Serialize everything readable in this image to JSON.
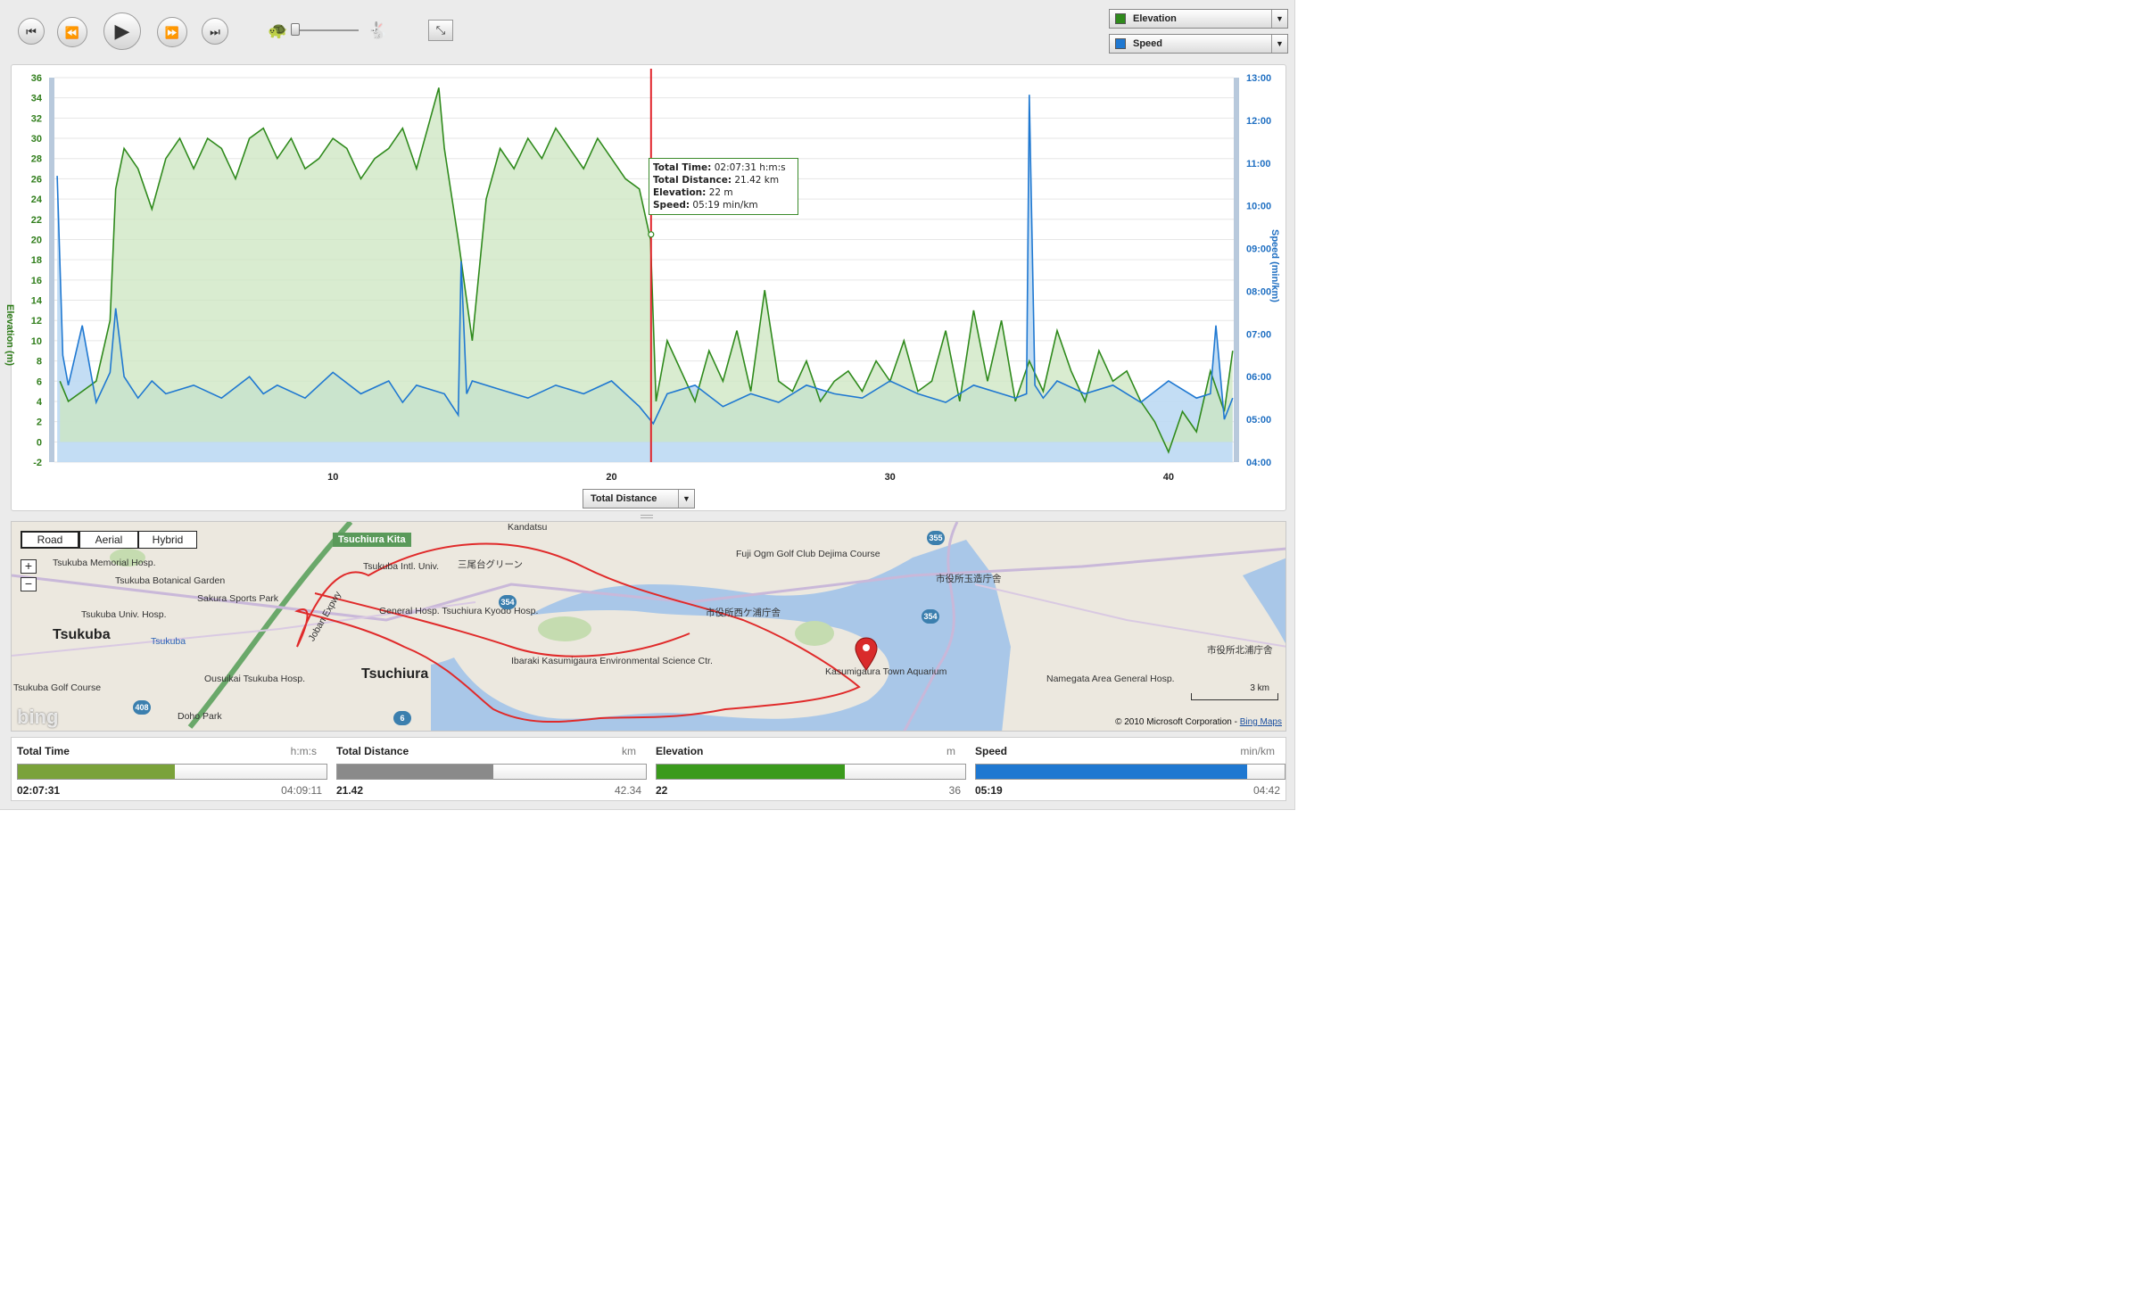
{
  "toolbar": {
    "buttons": [
      {
        "name": "skip-to-start-button",
        "glyph": "⏮"
      },
      {
        "name": "step-back-button",
        "glyph": "⏪"
      },
      {
        "name": "play-button",
        "glyph": "▶"
      },
      {
        "name": "step-forward-button",
        "glyph": "⏩"
      },
      {
        "name": "skip-to-end-button",
        "glyph": "⏭"
      }
    ],
    "slow_icon": "tortoise-icon",
    "fast_icon": "hare-icon",
    "fullscreen_icon": "collapse-icon"
  },
  "series_selectors": [
    {
      "label": "Elevation",
      "color": "#2f8a1c"
    },
    {
      "label": "Speed",
      "color": "#1f78d1"
    }
  ],
  "chart_data": {
    "type": "line",
    "left_axis": {
      "label": "Elevation (m)",
      "min": -2,
      "max": 36,
      "ticks": [
        "-2",
        "0",
        "2",
        "4",
        "6",
        "8",
        "10",
        "12",
        "14",
        "16",
        "18",
        "20",
        "22",
        "24",
        "26",
        "28",
        "30",
        "32",
        "34",
        "36"
      ]
    },
    "right_axis": {
      "label": "Speed (min/km)",
      "ticks": [
        "04:00",
        "05:00",
        "06:00",
        "07:00",
        "08:00",
        "09:00",
        "10:00",
        "11:00",
        "12:00",
        "13:00"
      ]
    },
    "x_axis": {
      "label": "Total Distance",
      "min": 0,
      "max": 42.34,
      "ticks": [
        "10",
        "20",
        "30",
        "40"
      ],
      "tick_values": [
        10,
        20,
        30,
        40
      ]
    },
    "cursor": {
      "x": 21.42
    },
    "series": [
      {
        "name": "Elevation",
        "color": "#2f8a1c",
        "fill": "#cce6c0",
        "x": [
          0.2,
          0.5,
          1,
          1.5,
          2,
          2.2,
          2.5,
          3,
          3.5,
          4,
          4.5,
          5,
          5.5,
          6,
          6.5,
          7,
          7.5,
          8,
          8.5,
          9,
          9.5,
          10,
          10.5,
          11,
          11.5,
          12,
          12.5,
          13,
          13.5,
          13.8,
          14,
          14.5,
          15,
          15.5,
          16,
          16.5,
          17,
          17.5,
          18,
          18.5,
          19,
          19.5,
          20,
          20.5,
          21,
          21.4,
          21.6,
          22,
          22.5,
          23,
          23.5,
          24,
          24.5,
          25,
          25.5,
          26,
          26.5,
          27,
          27.5,
          28,
          28.5,
          29,
          29.5,
          30,
          30.5,
          31,
          31.5,
          32,
          32.5,
          33,
          33.5,
          34,
          34.5,
          35,
          35.5,
          36,
          36.5,
          37,
          37.5,
          38,
          38.5,
          39,
          39.5,
          40,
          40.5,
          41,
          41.5,
          42,
          42.3
        ],
        "y": [
          6,
          4,
          5,
          6,
          12,
          25,
          29,
          27,
          23,
          28,
          30,
          27,
          30,
          29,
          26,
          30,
          31,
          28,
          30,
          27,
          28,
          30,
          29,
          26,
          28,
          29,
          31,
          27,
          32,
          35,
          29,
          20,
          10,
          24,
          29,
          27,
          30,
          28,
          31,
          29,
          27,
          30,
          28,
          26,
          25,
          20,
          4,
          10,
          7,
          4,
          9,
          6,
          11,
          5,
          15,
          6,
          5,
          8,
          4,
          6,
          7,
          5,
          8,
          6,
          10,
          5,
          6,
          11,
          4,
          13,
          6,
          12,
          4,
          8,
          5,
          11,
          7,
          4,
          9,
          6,
          7,
          4,
          2,
          -1,
          3,
          1,
          7,
          3,
          9
        ]
      },
      {
        "name": "Speed",
        "color": "#1f78d1",
        "fill": "#bdd9f3",
        "x": [
          0.1,
          0.3,
          0.5,
          1,
          1.5,
          2,
          2.2,
          2.5,
          3,
          3.5,
          4,
          5,
          6,
          7,
          7.5,
          8,
          9,
          10,
          11,
          12,
          12.5,
          13,
          14,
          14.5,
          14.6,
          14.8,
          15,
          16,
          17,
          18,
          19,
          20,
          21,
          21.5,
          22,
          23,
          24,
          25,
          26,
          27,
          28,
          29,
          30,
          31,
          32,
          33,
          34,
          34.5,
          34.9,
          35,
          35.2,
          35.5,
          36,
          37,
          38,
          39,
          40,
          41,
          41.5,
          41.7,
          42,
          42.3
        ],
        "y": [
          10.7,
          6.5,
          5.8,
          7.2,
          5.4,
          6.1,
          7.6,
          6.0,
          5.5,
          5.9,
          5.6,
          5.8,
          5.5,
          6.0,
          5.6,
          5.8,
          5.5,
          6.1,
          5.6,
          5.9,
          5.4,
          5.8,
          5.6,
          5.1,
          8.7,
          5.6,
          5.9,
          5.7,
          5.5,
          5.8,
          5.6,
          5.9,
          5.3,
          4.9,
          5.6,
          5.8,
          5.3,
          5.6,
          5.4,
          5.8,
          5.6,
          5.5,
          5.9,
          5.6,
          5.4,
          5.8,
          5.6,
          5.5,
          5.6,
          12.6,
          5.8,
          5.5,
          5.9,
          5.6,
          5.8,
          5.4,
          5.9,
          5.5,
          5.6,
          7.2,
          5.0,
          5.5
        ]
      }
    ]
  },
  "x_select": {
    "label": "Total Distance"
  },
  "tooltip": {
    "total_time_label": "Total Time:",
    "total_time_value": "02:07:31 h:m:s",
    "total_distance_label": "Total Distance:",
    "total_distance_value": "21.42 km",
    "elevation_label": "Elevation:",
    "elevation_value": "22 m",
    "speed_label": "Speed:",
    "speed_value": "05:19 min/km"
  },
  "map": {
    "types": [
      "Road",
      "Aerial",
      "Hybrid"
    ],
    "active_type": "Road",
    "zoom_in": "+",
    "zoom_out": "−",
    "badge": "Tsuchiura Kita",
    "labels": [
      {
        "text": "Tsukuba",
        "cls": "city"
      },
      {
        "text": "Tsuchiura",
        "cls": "city"
      },
      {
        "text": "Tsukuba Memorial Hosp.",
        "cls": ""
      },
      {
        "text": "Tsukuba Botanical Garden",
        "cls": ""
      },
      {
        "text": "Sakura Sports Park",
        "cls": ""
      },
      {
        "text": "Tsukuba Univ. Hosp.",
        "cls": ""
      },
      {
        "text": "Ousuikai Tsukuba Hosp.",
        "cls": ""
      },
      {
        "text": "Doho Park",
        "cls": ""
      },
      {
        "text": "Tsukuba Golf Course",
        "cls": ""
      },
      {
        "text": "Tsukuba Intl. Univ.",
        "cls": ""
      },
      {
        "text": "General Hosp. Tsuchiura Kyodo Hosp.",
        "cls": ""
      },
      {
        "text": "Ibaraki Kasumigaura Environmental Science Ctr.",
        "cls": ""
      },
      {
        "text": "Fuji Ogm Golf Club Dejima Course",
        "cls": ""
      },
      {
        "text": "市役所西ケ浦庁舎",
        "cls": ""
      },
      {
        "text": "市役所玉造庁舎",
        "cls": ""
      },
      {
        "text": "市役所北浦庁舎",
        "cls": ""
      },
      {
        "text": "Kasumigaura Town Aquarium",
        "cls": ""
      },
      {
        "text": "Namegata Area General Hosp.",
        "cls": ""
      },
      {
        "text": "三尾台グリーン",
        "cls": ""
      },
      {
        "text": "Kandatsu",
        "cls": ""
      },
      {
        "text": "Joban Expwy",
        "cls": ""
      },
      {
        "text": "Tsukuba",
        "cls": "blue"
      }
    ],
    "routes": [
      "354",
      "354",
      "355",
      "408",
      "6"
    ],
    "scale": "3 km",
    "copyright": "© 2010 Microsoft Corporation - ",
    "copyright_link": "Bing Maps",
    "logo": "bing"
  },
  "stats": [
    {
      "title": "Total Time",
      "unit": "h:m:s",
      "value": "02:07:31",
      "max": "04:09:11",
      "fraction": 0.51,
      "color": "#7aa23a"
    },
    {
      "title": "Total Distance",
      "unit": "km",
      "value": "21.42",
      "max": "42.34",
      "fraction": 0.506,
      "color": "#8a8a8a"
    },
    {
      "title": "Elevation",
      "unit": "m",
      "value": "22",
      "max": "36",
      "fraction": 0.61,
      "color": "#3a9a1c"
    },
    {
      "title": "Speed",
      "unit": "min/km",
      "value": "05:19",
      "max": "04:42",
      "fraction": 0.88,
      "color": "#1f78d1"
    }
  ]
}
